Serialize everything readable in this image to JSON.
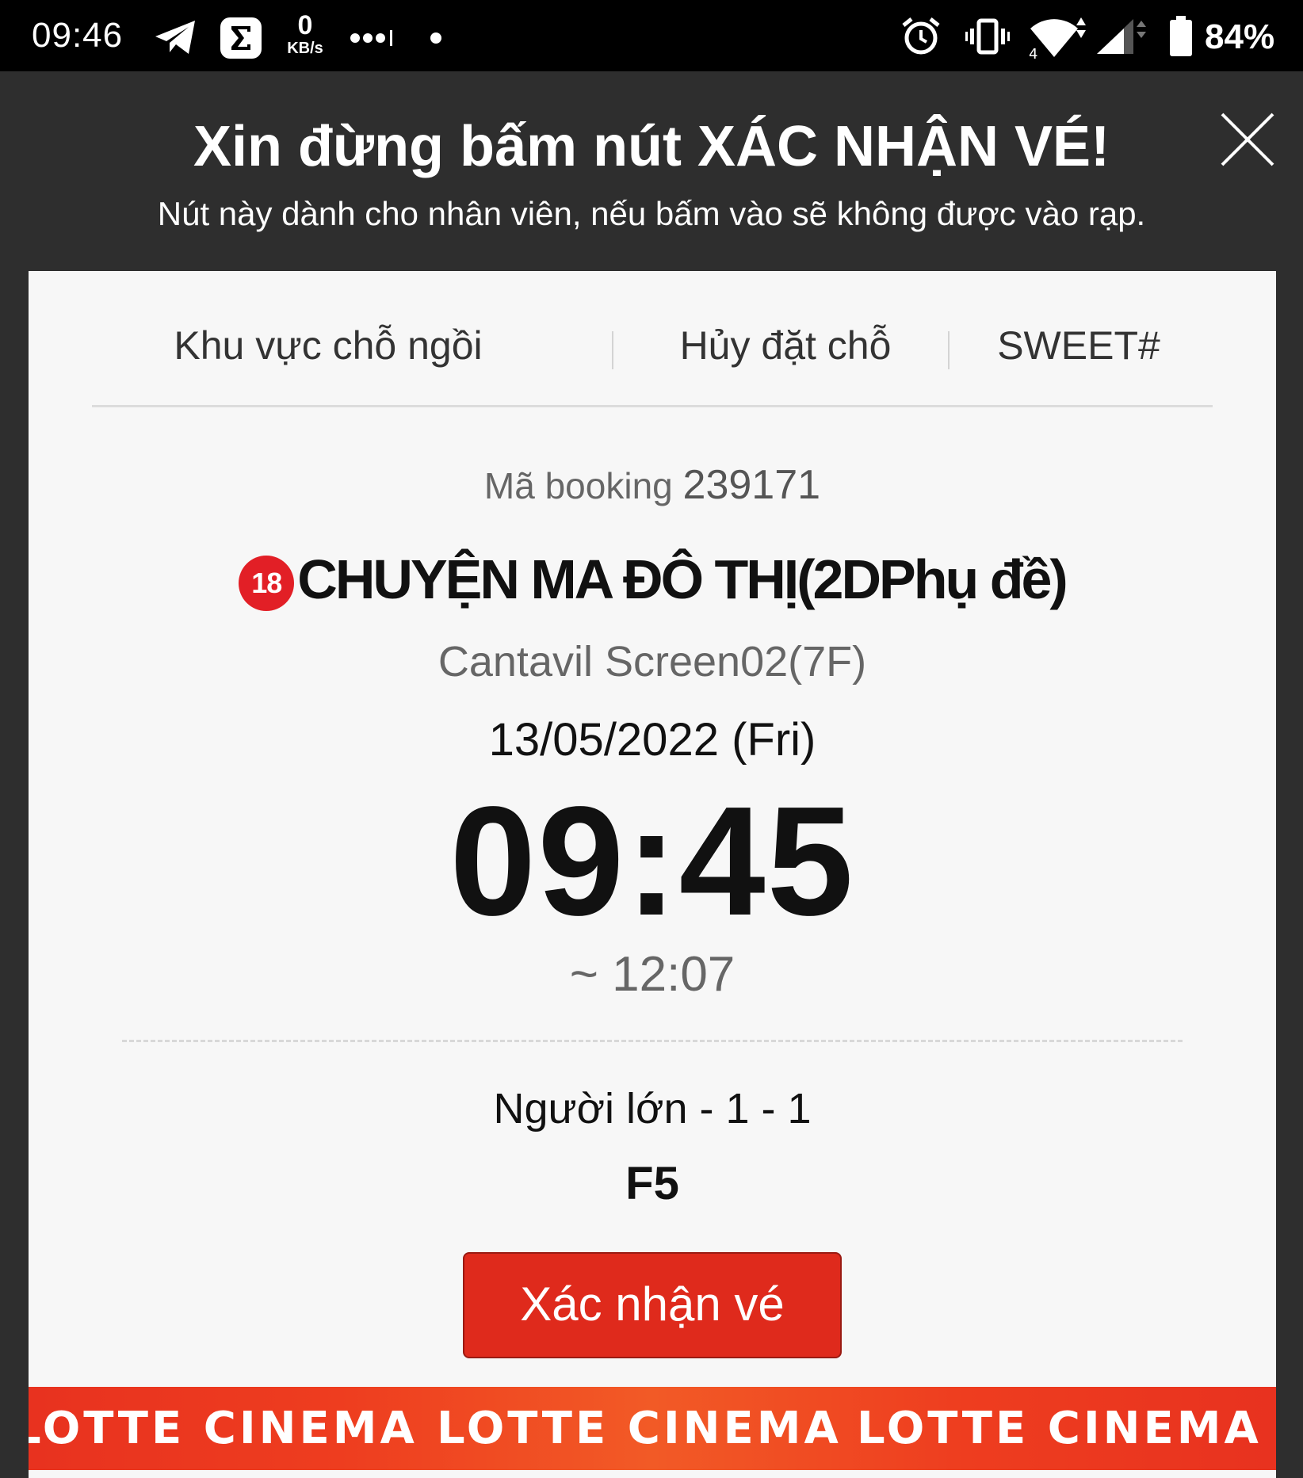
{
  "status_bar": {
    "time": "09:46",
    "net_speed_value": "0",
    "net_speed_unit": "KB/s",
    "battery_percent": "84%",
    "icons": [
      "telegram-icon",
      "sigma-app-icon",
      "more-dots-icon",
      "notification-dot-icon",
      "alarm-icon",
      "vibrate-icon",
      "wifi-icon",
      "cell-signal-icon",
      "battery-icon"
    ]
  },
  "warning": {
    "title": "Xin đừng bấm nút XÁC NHẬN VÉ!",
    "subtitle": "Nút này dành cho nhân viên, nếu bấm vào sẽ không được vào rạp.",
    "close_icon": "close-icon"
  },
  "ticket": {
    "nav": {
      "seat_area": "Khu vực chỗ ngồi",
      "cancel": "Hủy đặt chỗ",
      "sweet": "SWEET#"
    },
    "booking_label": "Mã booking",
    "booking_code": "239171",
    "age_rating": "18",
    "movie_title": "CHUYỆN MA ĐÔ THỊ(2DPhụ đề)",
    "screen": "Cantavil Screen02(7F)",
    "date": "13/05/2022 (Fri)",
    "start_time": "09:45",
    "end_time": "~ 12:07",
    "seat_type": "Người lớn - 1 - 1",
    "seat": "F5",
    "confirm_label": "Xác nhận vé"
  },
  "brand": {
    "text_1": "LOTTE CINEMA",
    "text_2": "LOTTE CINEMA",
    "text_3": "LOTTE CINEMA",
    "colors": {
      "accent": "#e21f26",
      "button": "#df2a1c",
      "strip": "#ee3d1f"
    }
  }
}
